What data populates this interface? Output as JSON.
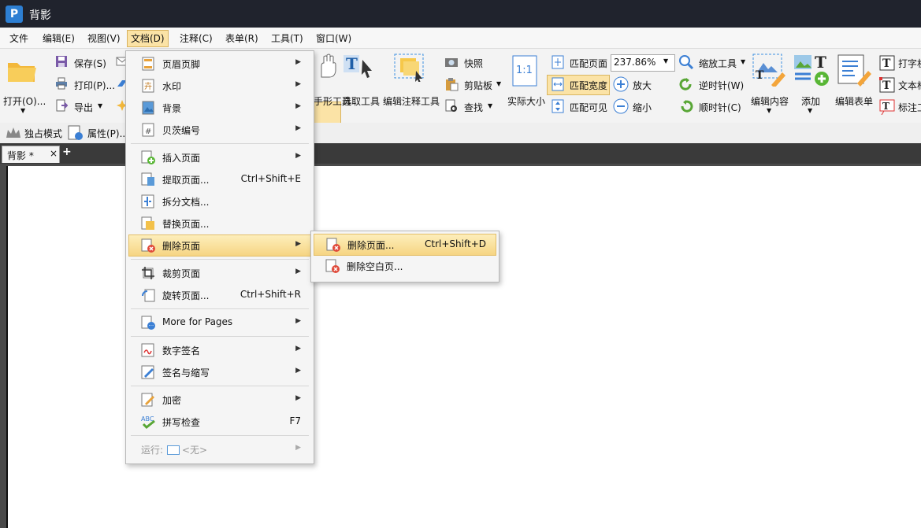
{
  "window": {
    "title": "背影"
  },
  "menubar": [
    "文件",
    "编辑(E)",
    "视图(V)",
    "文档(D)",
    "注释(C)",
    "表单(R)",
    "工具(T)",
    "窗口(W)"
  ],
  "ribbon": {
    "open": "打开(O)...",
    "save": "保存(S)",
    "print": "打印(P)...",
    "export": "导出",
    "hand": "手形工具",
    "select": "选取工具",
    "edit_annot": "编辑注释工具",
    "snapshot": "快照",
    "clipboard": "剪贴板",
    "find": "查找",
    "actual_size": "实际大小",
    "actual_size_icon": "1:1",
    "fit_page": "匹配页面",
    "fit_width": "匹配宽度",
    "fit_visible": "匹配可见",
    "zoom_value": "237.86%",
    "zoom_in": "放大",
    "zoom_out": "缩小",
    "zoom_tool": "缩放工具",
    "rotate_ccw": "逆时针(W)",
    "rotate_cw": "顺时针(C)",
    "edit_content": "编辑内容",
    "add": "添加",
    "edit_form": "编辑表单",
    "typewriter": "打字机",
    "textbox": "文本框",
    "callout": "标注工具"
  },
  "toolbar2": {
    "exclusive": "独占模式",
    "properties": "属性(P)..."
  },
  "tab": {
    "label": "背影 *",
    "close": "×",
    "new": "+"
  },
  "doc_menu": {
    "items": [
      {
        "label": "页眉页脚",
        "shortcut": "",
        "sub": true
      },
      {
        "label": "水印",
        "shortcut": "",
        "sub": true
      },
      {
        "label": "背景",
        "shortcut": "",
        "sub": true
      },
      {
        "label": "贝茨编号",
        "shortcut": "",
        "sub": true
      },
      {
        "label": "插入页面",
        "shortcut": "",
        "sub": true
      },
      {
        "label": "提取页面...",
        "shortcut": "Ctrl+Shift+E",
        "sub": false
      },
      {
        "label": "拆分文档...",
        "shortcut": "",
        "sub": false
      },
      {
        "label": "替换页面...",
        "shortcut": "",
        "sub": false
      },
      {
        "label": "删除页面",
        "shortcut": "",
        "sub": true
      },
      {
        "label": "裁剪页面",
        "shortcut": "",
        "sub": true
      },
      {
        "label": "旋转页面...",
        "shortcut": "Ctrl+Shift+R",
        "sub": false
      },
      {
        "label": "More for Pages",
        "shortcut": "",
        "sub": true
      },
      {
        "label": "数字签名",
        "shortcut": "",
        "sub": true
      },
      {
        "label": "签名与缩写",
        "shortcut": "",
        "sub": true
      },
      {
        "label": "加密",
        "shortcut": "",
        "sub": true
      },
      {
        "label": "拼写检查",
        "shortcut": "F7",
        "sub": false
      }
    ],
    "run_label": "运行:",
    "run_value": "<无>"
  },
  "delete_submenu": [
    {
      "label": "删除页面...",
      "shortcut": "Ctrl+Shift+D"
    },
    {
      "label": "删除空白页..."
    }
  ]
}
